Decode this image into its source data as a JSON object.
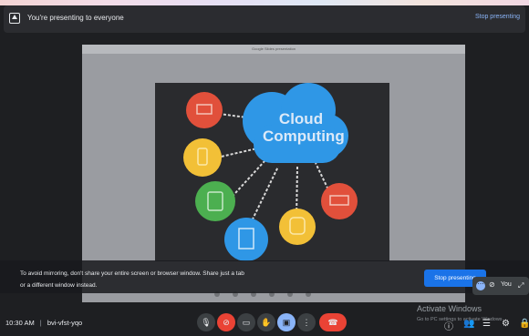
{
  "banner": {
    "text": "You're presenting to everyone",
    "stop_link": "Stop presenting"
  },
  "shared_screen": {
    "browser_title": "Google Slides presentation",
    "slide": {
      "title_line1": "Cloud",
      "title_line2": "Computing"
    }
  },
  "mirror_warning": {
    "line1": "To avoid mirroring, don't share your entire screen or browser window. Share just a tab",
    "line2": "or a different window instead.",
    "button": "Stop presenting"
  },
  "self_tile": {
    "label": "You"
  },
  "meeting": {
    "time": "10:30 AM",
    "separator": "|",
    "code": "bvi-vfst-yqo"
  },
  "watermark": {
    "title": "Activate Windows",
    "subtitle": "Go to PC settings to activate Windows."
  },
  "icons": {
    "mic": "mic-icon",
    "camera_off": "camera-off-icon",
    "captions": "captions-icon",
    "raise_hand": "raise-hand-icon",
    "present": "present-icon",
    "more": "more-options-icon",
    "end_call": "end-call-icon",
    "info": "info-icon",
    "people": "people-icon",
    "chat": "chat-icon",
    "activities": "activities-icon",
    "lock": "host-controls-icon"
  },
  "colors": {
    "accent": "#1a73e8",
    "danger": "#ea4335",
    "cloud": "#2f97e6"
  }
}
